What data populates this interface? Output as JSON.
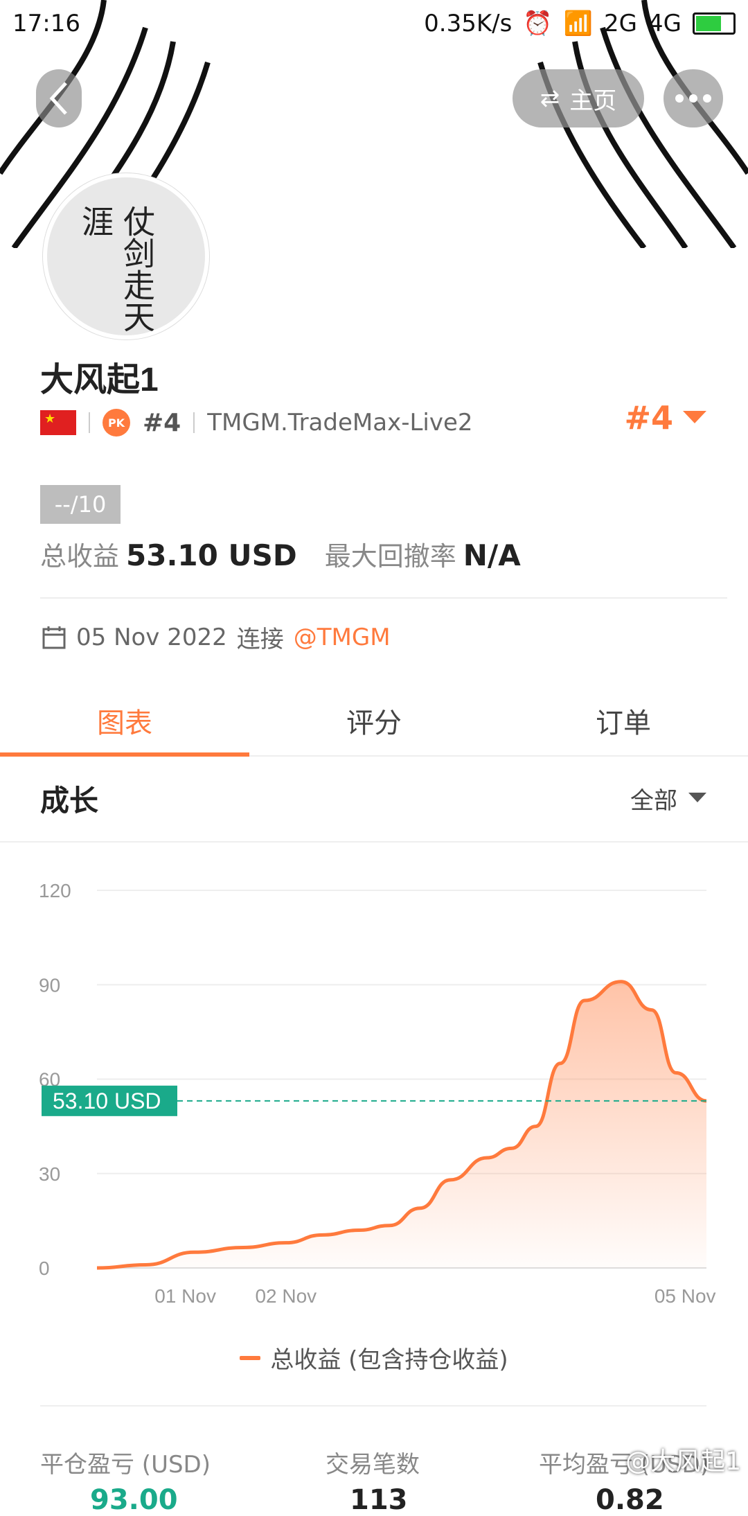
{
  "status_bar": {
    "time": "17:16",
    "network_speed": "0.35K/s",
    "signal_1": "2G",
    "signal_2": "4G"
  },
  "header": {
    "home_label": "主页",
    "avatar_text": "仗剑走天涯"
  },
  "profile": {
    "name": "大风起1",
    "country_flag": "china-flag",
    "pk_badge": "PK",
    "pk_rank": "#4",
    "server": "TMGM.TradeMax-Live2",
    "rank": "#4"
  },
  "summary": {
    "score": "--/10",
    "total_profit_label": "总收益",
    "total_profit_value": "53.10 USD",
    "max_drawdown_label": "最大回撤率",
    "max_drawdown_value": "N/A"
  },
  "connection": {
    "date": "05 Nov 2022",
    "verb": "连接",
    "broker": "@TMGM"
  },
  "tabs": [
    {
      "label": "图表",
      "active": true
    },
    {
      "label": "评分",
      "active": false
    },
    {
      "label": "订单",
      "active": false
    }
  ],
  "section": {
    "title": "成长",
    "filter": "全部"
  },
  "chart_data": {
    "type": "area",
    "title": "",
    "xlabel": "",
    "ylabel": "",
    "x_ticks": [
      "01 Nov",
      "02 Nov",
      "05 Nov"
    ],
    "y_ticks": [
      0,
      30,
      60,
      90,
      120
    ],
    "ylim": [
      0,
      120
    ],
    "reference_line": {
      "value": 53.1,
      "label": "53.10 USD"
    },
    "series": [
      {
        "name": "总收益 (包含持仓收益)",
        "points": [
          [
            0,
            0
          ],
          [
            0.08,
            1
          ],
          [
            0.16,
            5
          ],
          [
            0.24,
            6.5
          ],
          [
            0.31,
            8
          ],
          [
            0.37,
            10.5
          ],
          [
            0.43,
            12
          ],
          [
            0.48,
            13.5
          ],
          [
            0.53,
            19
          ],
          [
            0.58,
            28
          ],
          [
            0.64,
            35
          ],
          [
            0.68,
            38
          ],
          [
            0.72,
            45
          ],
          [
            0.76,
            65
          ],
          [
            0.8,
            85
          ],
          [
            0.86,
            91
          ],
          [
            0.91,
            82
          ],
          [
            0.95,
            62
          ],
          [
            1.0,
            53.1
          ]
        ]
      }
    ],
    "colors": {
      "line": "#ff7a3d",
      "reference": "#1aaa8a"
    }
  },
  "legend": {
    "label": "总收益 (包含持仓收益)"
  },
  "stats": [
    {
      "label": "平仓盈亏 (USD)",
      "value": "93.00"
    },
    {
      "label": "交易笔数",
      "value": "113"
    },
    {
      "label": "平均盈亏 (USD)",
      "value": "0.82"
    }
  ],
  "watermark": "@大风起1"
}
